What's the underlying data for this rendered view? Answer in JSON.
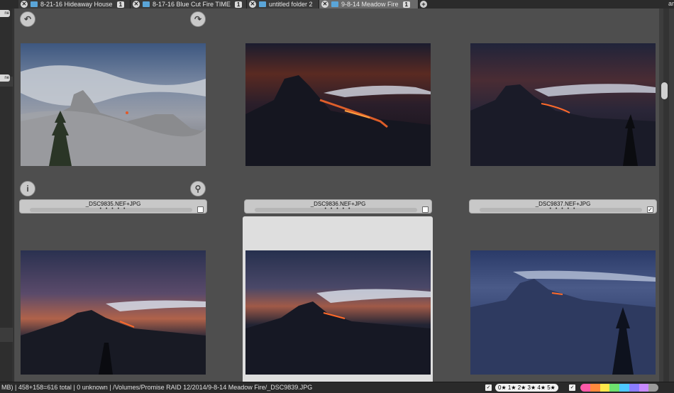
{
  "tabs": [
    {
      "label": "8-21-16 Hideaway House",
      "count": "1",
      "active": false
    },
    {
      "label": "8-17-16 Blue Cut Fire TIME",
      "count": "1",
      "active": false
    },
    {
      "label": "untitled folder 2",
      "count": "1",
      "active": false
    },
    {
      "label": "9-8-14 Meadow Fire",
      "count": "1",
      "active": true
    }
  ],
  "tab_close_glyph": "✕",
  "tab_add_glyph": "+",
  "tab_overflow": "ar",
  "sidebar": {
    "chip_top": "ne",
    "chip_mid": "ne"
  },
  "thumbnails": [
    {
      "filename": "_DSC9835.NEF+JPG",
      "dots": "• • • • •",
      "checked": false,
      "scene": "day"
    },
    {
      "filename": "_DSC9836.NEF+JPG",
      "dots": "• • • • •",
      "checked": false,
      "scene": "night-red"
    },
    {
      "filename": "_DSC9837.NEF+JPG",
      "dots": "• • • • •",
      "checked": true,
      "scene": "night-red-2"
    },
    {
      "filename": "",
      "dots": "",
      "checked": false,
      "scene": "dusk-blue"
    },
    {
      "filename": "",
      "dots": "",
      "checked": false,
      "scene": "dusk-blue-2",
      "selected": true
    },
    {
      "filename": "",
      "dots": "",
      "checked": false,
      "scene": "blue-dome"
    }
  ],
  "toolbar_icons": {
    "rotate_left": "rotate-left-icon",
    "rotate_right": "rotate-right-icon",
    "info": "info-icon",
    "zoom": "magnifier-icon"
  },
  "status": {
    "text": "MB) | 458+158=616 total | 0 unknown | /Volumes/Promise RAID 12/2014/9-8-14 Meadow Fire/_DSC9839.JPG",
    "checkbox_mark": "✓",
    "ratings": "0★ 1★ 2★ 3★ 4★ 5★"
  },
  "colors": {
    "accent": "#5aa5d8",
    "label_swatches": [
      "#ff5aa8",
      "#ff8a3d",
      "#ffe94a",
      "#6ee06e",
      "#4ec8ff",
      "#8a7dff",
      "#c78aff",
      "#9a9a9a"
    ]
  }
}
